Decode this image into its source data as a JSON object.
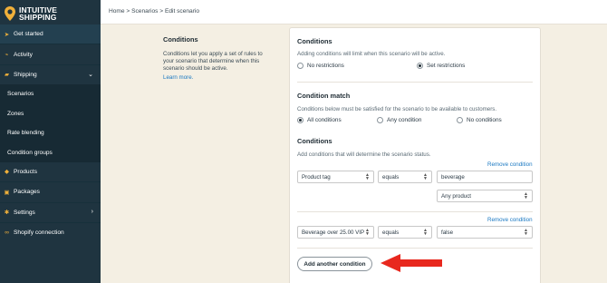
{
  "brand": {
    "name_line1": "INTUITIVE",
    "name_line2": "SHIPPING"
  },
  "sidebar": {
    "items": [
      {
        "label": "Get started",
        "icon": "rocket-icon"
      },
      {
        "label": "Activity",
        "icon": "activity-icon"
      },
      {
        "label": "Shipping",
        "icon": "truck-icon"
      },
      {
        "label": "Scenarios"
      },
      {
        "label": "Zones"
      },
      {
        "label": "Rate blending"
      },
      {
        "label": "Condition groups"
      },
      {
        "label": "Products",
        "icon": "tag-icon"
      },
      {
        "label": "Packages",
        "icon": "package-icon"
      },
      {
        "label": "Settings",
        "icon": "gear-icon"
      },
      {
        "label": "Shopify connection",
        "icon": "link-icon"
      }
    ]
  },
  "breadcrumb": "Home > Scenarios > Edit scenario",
  "description": {
    "title": "Conditions",
    "text": "Conditions let you apply a set of rules to your scenario that determine when this scenario should be active.",
    "link": "Learn more."
  },
  "card": {
    "conditions_title": "Conditions",
    "conditions_help": "Adding conditions will limit when this scenario will be active.",
    "restriction_options": [
      "No restrictions",
      "Set restrictions"
    ],
    "restriction_selected": "Set restrictions",
    "match_title": "Condition match",
    "match_help": "Conditions below must be satisfied for the scenario to be available to customers.",
    "match_options": [
      "All conditions",
      "Any condition",
      "No conditions"
    ],
    "match_selected": "All conditions",
    "list_title": "Conditions",
    "list_help": "Add conditions that will determine the scenario status.",
    "remove_label": "Remove condition",
    "condition1": {
      "field": "Product tag",
      "operator": "equals",
      "value": "beverage",
      "scope": "Any product"
    },
    "condition2": {
      "field": "Beverage over 25.00 VIP",
      "operator": "equals",
      "value": "false"
    },
    "add_button": "Add another condition"
  },
  "colors": {
    "sidebar": "#1f3440",
    "accent": "#f0b03a",
    "link": "#1a78c2",
    "annotation_arrow": "#e8281e"
  }
}
